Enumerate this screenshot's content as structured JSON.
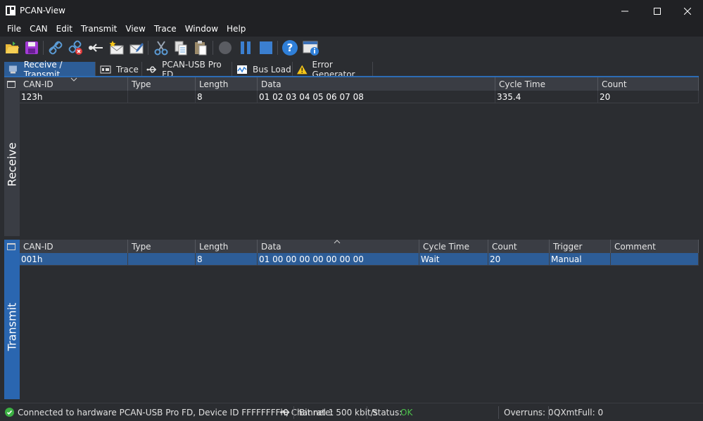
{
  "window": {
    "title": "PCAN-View"
  },
  "menu": [
    "File",
    "CAN",
    "Edit",
    "Transmit",
    "View",
    "Trace",
    "Window",
    "Help"
  ],
  "toolbar": {
    "icons": [
      "open-icon",
      "save-icon",
      "connect-icon",
      "disconnect-icon",
      "reset-icon",
      "new-message-icon",
      "edit-message-icon",
      "cut-icon",
      "copy-icon",
      "paste-icon",
      "record-icon",
      "pause-icon",
      "stop-icon",
      "help-icon",
      "info-icon"
    ]
  },
  "tabs": [
    {
      "label": "Receive / Transmit",
      "icon": "receive-transmit-icon",
      "active": true
    },
    {
      "label": "Trace",
      "icon": "trace-icon",
      "active": false
    },
    {
      "label": "PCAN-USB Pro FD",
      "icon": "usb-icon",
      "active": false
    },
    {
      "label": "Bus Load",
      "icon": "bus-load-icon",
      "active": false
    },
    {
      "label": "Error Generator",
      "icon": "warning-icon",
      "active": false
    }
  ],
  "receive": {
    "side_label": "Receive",
    "columns": [
      "CAN-ID",
      "Type",
      "Length",
      "Data",
      "Cycle Time",
      "Count"
    ],
    "rows": [
      {
        "can_id": "123h",
        "type": "",
        "length": "8",
        "data": "01 02 03 04 05 06 07 08",
        "cycle_time": "335.4",
        "count": "20"
      }
    ]
  },
  "transmit": {
    "side_label": "Transmit",
    "columns": [
      "CAN-ID",
      "Type",
      "Length",
      "Data",
      "Cycle Time",
      "Count",
      "Trigger",
      "Comment"
    ],
    "rows": [
      {
        "can_id": "001h",
        "type": "",
        "length": "8",
        "data": "01 00 00 00 00 00 00 00",
        "cycle_time": "Wait",
        "count": "20",
        "trigger": "Manual",
        "comment": ""
      }
    ]
  },
  "status": {
    "connection": "Connected to hardware PCAN-USB Pro FD, Device ID FFFFFFFFh, Channel 1",
    "bitrate": "Bit rate: 500 kbit/s",
    "status_label": "Status:",
    "status_value": "OK",
    "overruns": "Overruns: 0",
    "qxmtfull": "QXmtFull: 0"
  },
  "colors": {
    "accent": "#2d5d97",
    "ok": "#4cc24c",
    "background": "#2b2d31"
  }
}
